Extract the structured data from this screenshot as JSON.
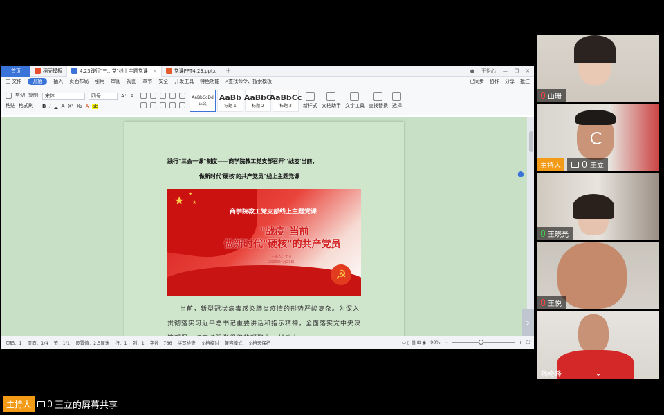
{
  "wps": {
    "tabs": [
      {
        "label": "首页"
      },
      {
        "label": "稻壳模板"
      },
      {
        "label": "4.23践行\"三...党\"线上主题党课"
      },
      {
        "label": "党课PPT4.23.pptx"
      }
    ],
    "user_name": "王怡心",
    "menu": [
      "三 文件",
      "开始",
      "插入",
      "页面布局",
      "引用",
      "审阅",
      "视图",
      "章节",
      "安全",
      "开发工具",
      "特色功能",
      "查找命令、搜索模板"
    ],
    "menu_right": [
      "已同步",
      "协作",
      "分享",
      "批注"
    ],
    "ribbon": {
      "paste": "粘贴",
      "cut": "剪切",
      "copy": "复制",
      "format_painter": "格式刷",
      "font_name": "宋体",
      "font_size": "四号",
      "styles": [
        {
          "preview": "AaBbCcDd",
          "name": "正文"
        },
        {
          "preview": "AaBb",
          "name": "标题 1"
        },
        {
          "preview": "AaBbC",
          "name": "标题 2"
        },
        {
          "preview": "AaBbCc",
          "name": "标题 3"
        }
      ],
      "new_style": "新样式",
      "text_assistant": "文字工具",
      "typesetting": "文档助手",
      "find_replace": "查找替换",
      "select": "选择"
    },
    "doc": {
      "title_line1": "践行\"三会一课\"制度——商学院教工党支部召开\"'战疫'当前，",
      "title_line2": "做新时代'硬核'的共产党员\"线上主题党课",
      "banner_sub": "商学院教工党支部线上主题党课",
      "banner_main1": "\"战疫\"当前",
      "banner_main2": "做新时代\"硬核\"的共产党员",
      "banner_small1": "主讲人：王立",
      "banner_small2": "2020年4月23日",
      "body": "当前，新型冠状病毒感染肺炎疫情的形势严峻复杂。为深入贯彻落实习近平总书记重要讲话和指示精神，全面落实党中央决策部署，切实增强党组织的凝聚力、战斗力"
    },
    "status": {
      "page": "页码：1",
      "pages": "页面：1/4",
      "section": "节：1/1",
      "setting": "设置值：2.5厘米",
      "row": "行：1",
      "col": "列：1",
      "words": "字数：766",
      "spell": "拼写检查",
      "proofread": "文档校对",
      "compat": "兼容模式",
      "protect": "文档未保护",
      "zoom": "90%",
      "zoom_fraction": 0.46
    }
  },
  "participants": [
    {
      "name": "山珊",
      "mic": "muted",
      "host": false
    },
    {
      "name": "王立",
      "mic": "on",
      "host": true,
      "host_label": "主持人"
    },
    {
      "name": "王晓光",
      "mic": "active",
      "host": false
    },
    {
      "name": "王悦",
      "mic": "muted",
      "host": false
    },
    {
      "name": "杨奇峰",
      "mic": "none",
      "host": false
    }
  ],
  "share_bar": {
    "host_label": "主持人",
    "text": "王立的屏幕共享"
  },
  "colors": {
    "accent": "#3a74d8",
    "host_orange": "#f39b17",
    "doc_bg": "#c8e0c6"
  }
}
